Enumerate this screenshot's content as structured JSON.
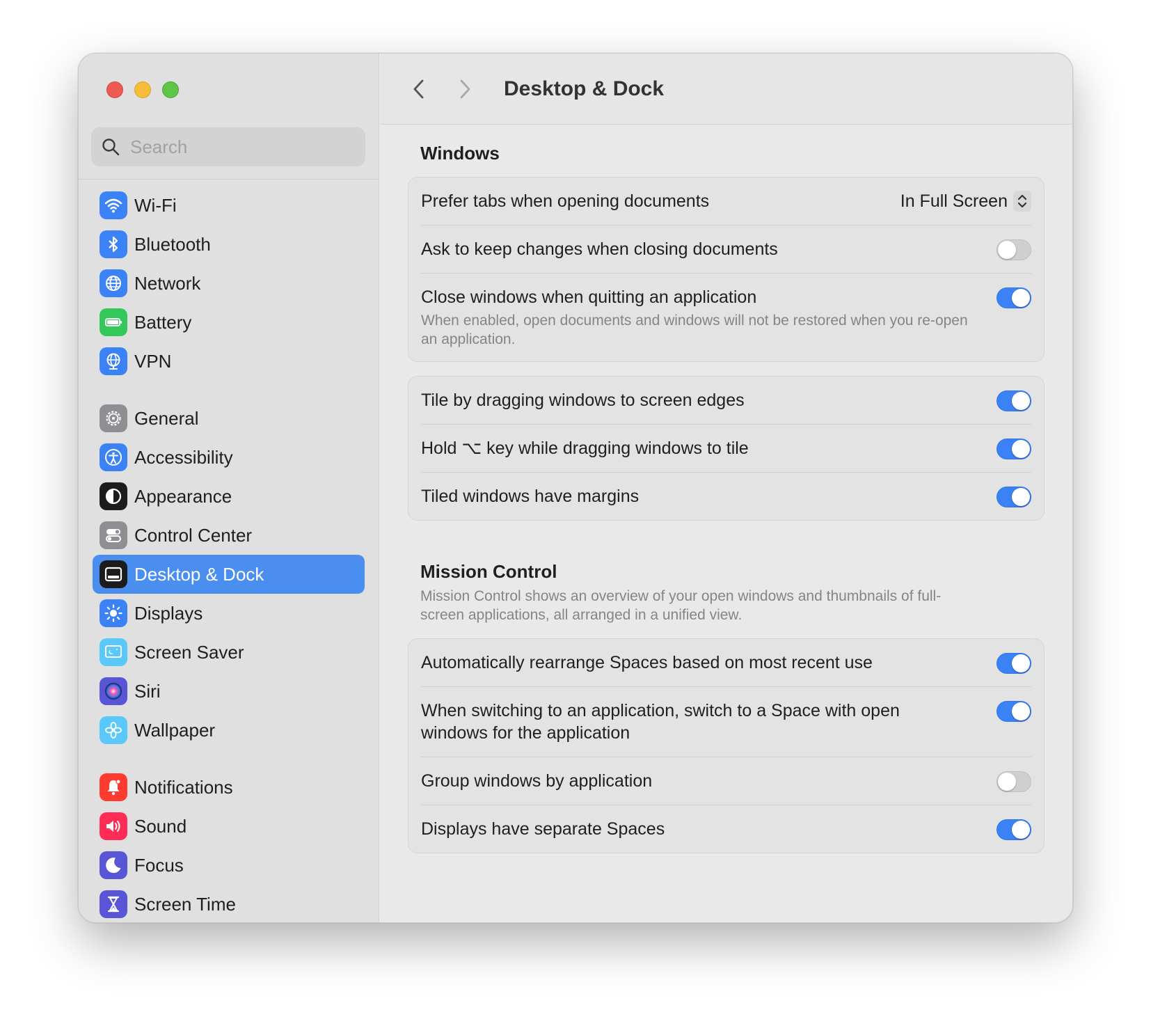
{
  "sidebar": {
    "search_placeholder": "Search",
    "groups": [
      [
        {
          "label": "Wi-Fi",
          "icon": "wifi-icon",
          "color": "#3b82f6"
        },
        {
          "label": "Bluetooth",
          "icon": "bluetooth-icon",
          "color": "#3b82f6"
        },
        {
          "label": "Network",
          "icon": "globe-icon",
          "color": "#3b82f6"
        },
        {
          "label": "Battery",
          "icon": "battery-icon",
          "color": "#34c759"
        },
        {
          "label": "VPN",
          "icon": "vpn-globe-icon",
          "color": "#3b82f6"
        }
      ],
      [
        {
          "label": "General",
          "icon": "gear-icon",
          "color": "#8e8e93"
        },
        {
          "label": "Accessibility",
          "icon": "accessibility-icon",
          "color": "#3b82f6"
        },
        {
          "label": "Appearance",
          "icon": "appearance-icon",
          "color": "#1c1c1e"
        },
        {
          "label": "Control Center",
          "icon": "control-center-icon",
          "color": "#8e8e93"
        },
        {
          "label": "Desktop & Dock",
          "icon": "dock-icon",
          "color": "#1c1c1e",
          "selected": true
        },
        {
          "label": "Displays",
          "icon": "sun-icon",
          "color": "#3b82f6"
        },
        {
          "label": "Screen Saver",
          "icon": "screen-saver-icon",
          "color": "#5ac8fa"
        },
        {
          "label": "Siri",
          "icon": "siri-icon",
          "color": "#5856d6"
        },
        {
          "label": "Wallpaper",
          "icon": "flower-icon",
          "color": "#5ac8fa"
        }
      ],
      [
        {
          "label": "Notifications",
          "icon": "bell-icon",
          "color": "#ff3b30"
        },
        {
          "label": "Sound",
          "icon": "speaker-icon",
          "color": "#ff2d55"
        },
        {
          "label": "Focus",
          "icon": "moon-icon",
          "color": "#5856d6"
        },
        {
          "label": "Screen Time",
          "icon": "hourglass-icon",
          "color": "#5856d6"
        }
      ]
    ]
  },
  "header": {
    "title": "Desktop & Dock"
  },
  "windows_section": {
    "title": "Windows",
    "rows": [
      {
        "label": "Prefer tabs when opening documents",
        "type": "select",
        "value": "In Full Screen"
      },
      {
        "label": "Ask to keep changes when closing documents",
        "type": "toggle",
        "on": false
      },
      {
        "label": "Close windows when quitting an application",
        "sub": "When enabled, open documents and windows will not be restored when you re-open an application.",
        "type": "toggle",
        "on": true
      }
    ]
  },
  "tiling_section": {
    "rows": [
      {
        "label": "Tile by dragging windows to screen edges",
        "type": "toggle",
        "on": true
      },
      {
        "label": "Hold ⌥ key while dragging windows to tile",
        "type": "toggle",
        "on": true
      },
      {
        "label": "Tiled windows have margins",
        "type": "toggle",
        "on": true
      }
    ]
  },
  "mission_control": {
    "title": "Mission Control",
    "desc": "Mission Control shows an overview of your open windows and thumbnails of full-screen applications, all arranged in a unified view.",
    "rows": [
      {
        "label": "Automatically rearrange Spaces based on most recent use",
        "type": "toggle",
        "on": true
      },
      {
        "label": "When switching to an application, switch to a Space with open windows for the application",
        "type": "toggle",
        "on": true
      },
      {
        "label": "Group windows by application",
        "type": "toggle",
        "on": false
      },
      {
        "label": "Displays have separate Spaces",
        "type": "toggle",
        "on": true
      }
    ]
  },
  "accent_color": "#3a82f6"
}
